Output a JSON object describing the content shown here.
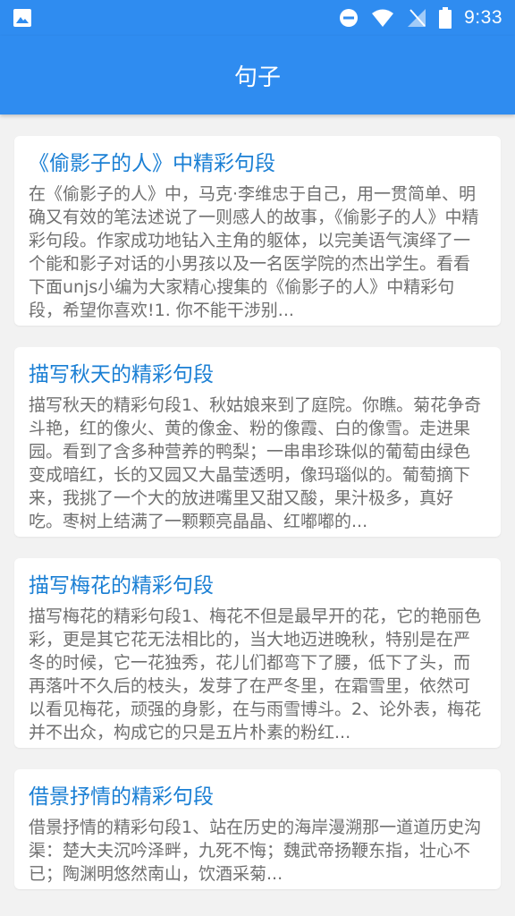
{
  "status": {
    "time": "9:33"
  },
  "header": {
    "title": "句子"
  },
  "articles": [
    {
      "title": "《偷影子的人》中精彩句段",
      "summary": "在《偷影子的人》中，马克·李维忠于自己，用一贯简单、明确又有效的笔法述说了一则感人的故事，《偷影子的人》中精彩句段。作家成功地钻入主角的躯体，以完美语气演绎了一个能和影子对话的小男孩以及一名医学院的杰出学生。看看下面unjs小编为大家精心搜集的《偷影子的人》中精彩句段，希望你喜欢!1. 你不能干涉别..."
    },
    {
      "title": "描写秋天的精彩句段",
      "summary": "描写秋天的精彩句段1、秋姑娘来到了庭院。你瞧。菊花争奇斗艳，红的像火、黄的像金、粉的像霞、白的像雪。走进果园。看到了含多种营养的鸭梨；一串串珍珠似的葡萄由绿色变成暗红，长的又园又大晶莹透明，像玛瑙似的。葡萄摘下来，我挑了一个大的放进嘴里又甜又酸，果汁极多，真好吃。枣树上结满了一颗颗亮晶晶、红嘟嘟的..."
    },
    {
      "title": "描写梅花的精彩句段",
      "summary": "描写梅花的精彩句段1、梅花不但是最早开的花，它的艳丽色彩，更是其它花无法相比的，当大地迈进晚秋，特别是在严冬的时候，它一花独秀，花儿们都弯下了腰，低下了头，而再落叶不久后的枝头，发芽了在严冬里，在霜雪里，依然可以看见梅花，顽强的身影，在与雨雪博斗。2、论外表，梅花并不出众，构成它的只是五片朴素的粉红..."
    },
    {
      "title": "借景抒情的精彩句段",
      "summary": "借景抒情的精彩句段1、站在历史的海岸漫溯那一道道历史沟渠：楚大夫沉吟泽畔，九死不悔；魏武帝扬鞭东指，壮心不已；陶渊明悠然南山，饮酒采菊..."
    }
  ]
}
